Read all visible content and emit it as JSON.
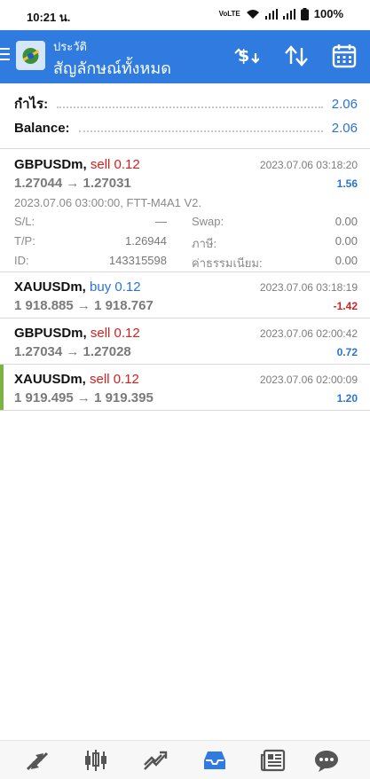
{
  "status_bar": {
    "time": "10:21 น.",
    "volte": "VoLTE",
    "battery": "100%"
  },
  "app_bar": {
    "subtitle": "ประวัติ",
    "title": "สัญลักษณ์ทั้งหมด",
    "actions": [
      "dollar-sort-icon",
      "sort-arrows-icon",
      "calendar-icon"
    ]
  },
  "summary": {
    "profit_label": "กำไร:",
    "profit_value": "2.06",
    "balance_label": "Balance:",
    "balance_value": "2.06"
  },
  "positions": [
    {
      "symbol": "GBPUSDm,",
      "side": "sell 0.12",
      "time": "2023.07.06 03:18:20",
      "prices": "1.27044 → 1.27031",
      "profit": "1.56",
      "expanded": {
        "comment": "2023.07.06 03:00:00, FTT-M4A1 V2.",
        "sl_label": "S/L:",
        "sl_value": "—",
        "swap_label": "Swap:",
        "swap_value": "0.00",
        "tp_label": "T/P:",
        "tp_value": "1.26944",
        "tax_label": "ภาษี:",
        "tax_value": "0.00",
        "id_label": "ID:",
        "id_value": "143315598",
        "fee_label": "ค่าธรรมเนียม:",
        "fee_value": "0.00"
      }
    },
    {
      "symbol": "XAUUSDm,",
      "side": "buy 0.12",
      "time": "2023.07.06 03:18:19",
      "prices": "1 918.885 → 1 918.767",
      "profit": "-1.42"
    },
    {
      "symbol": "GBPUSDm,",
      "side": "sell 0.12",
      "time": "2023.07.06 02:00:42",
      "prices": "1.27034 → 1.27028",
      "profit": "0.72"
    },
    {
      "symbol": "XAUUSDm,",
      "side": "sell 0.12",
      "time": "2023.07.06 02:00:09",
      "prices": "1 919.495 → 1 919.395",
      "profit": "1.20"
    }
  ],
  "bottom_nav": [
    "quotes-icon",
    "chart-icon",
    "trade-icon",
    "history-icon",
    "news-icon",
    "chat-icon"
  ],
  "colors": {
    "app_bar": "#2f7be0",
    "profit_blue": "#2a73d6",
    "sell_red": "#d02020",
    "loss_red": "#c62828",
    "selected_accent": "#7cb342"
  }
}
